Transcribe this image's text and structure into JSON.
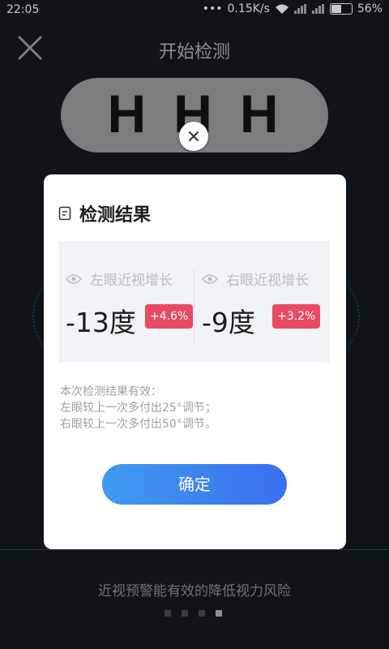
{
  "status_bar": {
    "time": "22:05",
    "network_speed": "0.15K/s",
    "battery": "56%"
  },
  "header": {
    "title": "开始检测"
  },
  "test_chart": {
    "letters": "HHH"
  },
  "dialog": {
    "title": "检测结果",
    "left_eye": {
      "label": "左眼近视增长",
      "value": "-13度",
      "change": "+4.6%"
    },
    "right_eye": {
      "label": "右眼近视增长",
      "value": "-9度",
      "change": "+3.2%"
    },
    "note_lines": [
      "本次检测结果有效：",
      "左眼较上一次多付出25°调节；",
      "右眼较上一次多付出50°调节。"
    ],
    "confirm_label": "确定"
  },
  "footer": {
    "slogan": "近视预警能有效的降低视力风险",
    "page_indicator": {
      "total": 4,
      "active": 4
    }
  },
  "colors": {
    "accent_start": "#3f9bf0",
    "accent_end": "#3b6ef0",
    "badge": "#e84a63",
    "background": "#0f1418"
  }
}
